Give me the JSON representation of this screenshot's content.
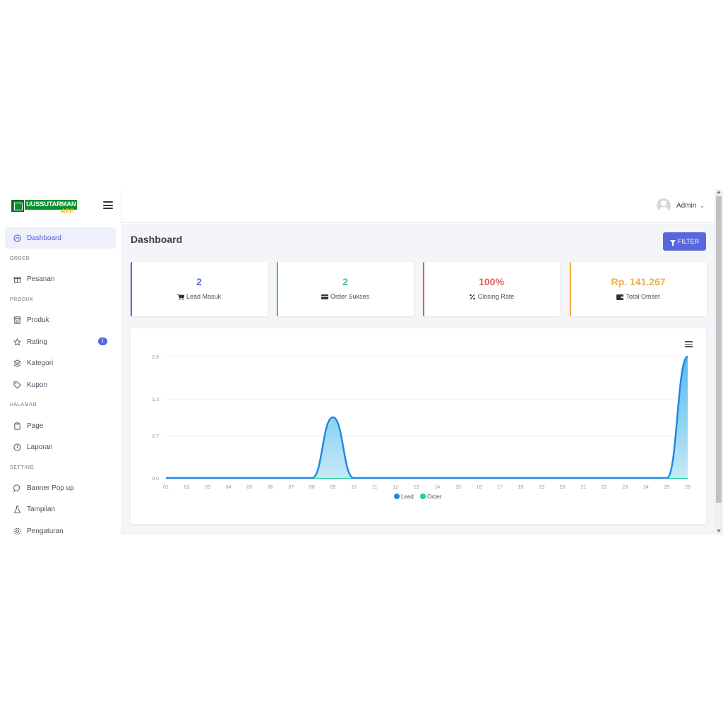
{
  "brand": {
    "name": "UUSSUTARMAN",
    "tag": "APP"
  },
  "sidebar": {
    "dashboard": {
      "label": "Dashboard"
    },
    "sections": {
      "order": "ORDER",
      "produk": "PRODUK",
      "halaman": "HALAMAN",
      "setting": "SETTING"
    },
    "items": {
      "pesanan": "Pesanan",
      "produk": "Produk",
      "rating": "Rating",
      "rating_badge": "1",
      "kategori": "Kategori",
      "kupon": "Kupon",
      "page": "Page",
      "laporan": "Laporan",
      "banner": "Banner Pop up",
      "tampilan": "Tampilan",
      "pengaturan": "Pengaturan"
    }
  },
  "topbar": {
    "user_name": "Admin",
    "caret": "⌄"
  },
  "main": {
    "title": "Dashboard",
    "filter_label": "FILTER",
    "stats": [
      {
        "value": "2",
        "label": "Lead Masuk",
        "color": "#5867dd"
      },
      {
        "value": "2",
        "label": "Order Sukses",
        "color": "#34bfa3"
      },
      {
        "value": "100%",
        "label": "Closing Rate",
        "color": "#e55b57"
      },
      {
        "value": "Rp. 141.267",
        "label": "Total Omset",
        "color": "#efb043"
      }
    ]
  },
  "colors": {
    "accent": "#5867dd",
    "lead": "#1e88e5",
    "order": "#1dd1a1"
  },
  "chart_data": {
    "type": "area",
    "categories": [
      "01",
      "02",
      "03",
      "04",
      "05",
      "06",
      "07",
      "08",
      "09",
      "10",
      "11",
      "12",
      "13",
      "14",
      "15",
      "16",
      "17",
      "18",
      "19",
      "20",
      "21",
      "22",
      "23",
      "24",
      "25",
      "26"
    ],
    "yticks": [
      "0.0",
      "0.7",
      "1.3",
      "2.0"
    ],
    "ylim": [
      0,
      2
    ],
    "series": [
      {
        "name": "Lead",
        "values": [
          0,
          0,
          0,
          0,
          0,
          0,
          0,
          0,
          1,
          0,
          0,
          0,
          0,
          0,
          0,
          0,
          0,
          0,
          0,
          0,
          0,
          0,
          0,
          0,
          0,
          2
        ]
      },
      {
        "name": "Order",
        "values": [
          0,
          0,
          0,
          0,
          0,
          0,
          0,
          0,
          0,
          0,
          0,
          0,
          0,
          0,
          0,
          0,
          0,
          0,
          0,
          0,
          0,
          0,
          0,
          0,
          0,
          0
        ]
      }
    ],
    "legend": "bottom-center",
    "grid": true
  }
}
